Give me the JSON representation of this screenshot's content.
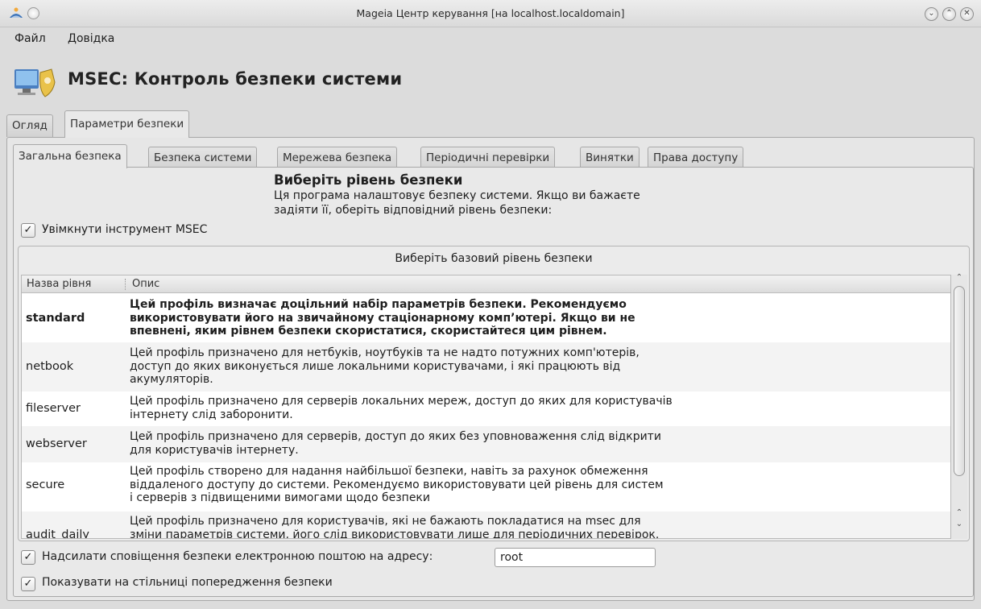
{
  "window": {
    "title": "Mageia Центр керування  [на localhost.localdomain]"
  },
  "menu": {
    "items": [
      "Файл",
      "Довідка"
    ]
  },
  "header": {
    "title": "MSEC: Контроль безпеки системи",
    "icon": "msec-shield-icon"
  },
  "main_tabs": [
    {
      "label": "Огляд",
      "active": false
    },
    {
      "label": "Параметри безпеки",
      "active": true
    }
  ],
  "sub_tabs": [
    {
      "label": "Загальна безпека",
      "active": true
    },
    {
      "label": "Безпека системи",
      "active": false
    },
    {
      "label": "Мережева безпека",
      "active": false
    },
    {
      "label": "Періодичні перевірки",
      "active": false
    },
    {
      "label": "Винятки",
      "active": false
    },
    {
      "label": "Права доступу",
      "active": false
    }
  ],
  "intro": {
    "heading": "Виберіть рівень безпеки",
    "line1": "Ця програма налаштовує безпеку системи. Якщо ви бажаєте",
    "line2": "задіяти її, оберіть відповідний рівень безпеки:"
  },
  "enable_msec": {
    "label": "Увімкнути інструмент MSEC",
    "checked": true,
    "mark": "✓"
  },
  "levels": {
    "group_title": "Виберіть базовий рівень безпеки",
    "columns": [
      "Назва рівня",
      "Опис"
    ],
    "rows": [
      {
        "name": "standard",
        "selected": true,
        "lines": [
          "Цей профіль визначає доцільний набір параметрів безпеки. Рекомендуємо",
          "використовувати його на звичайному стаціонарному комп’ютері. Якщо ви не",
          "впевнені, яким рівнем безпеки скористатися, скористайтеся цим рівнем."
        ]
      },
      {
        "name": "netbook",
        "selected": false,
        "lines": [
          "Цей профіль призначено для нетбуків, ноутбуків та не надто потужних комп'ютерів,",
          "доступ до яких виконується лише локальними користувачами, і які працюють від",
          "акумуляторів."
        ]
      },
      {
        "name": "fileserver",
        "selected": false,
        "lines": [
          "Цей профіль призначено для серверів локальних мереж, доступ до яких для користувачів",
          "інтернету слід заборонити."
        ]
      },
      {
        "name": "webserver",
        "selected": false,
        "lines": [
          "Цей профіль призначено для серверів, доступ до яких без уповноваження слід відкрити",
          "для користувачів інтернету."
        ]
      },
      {
        "name": "secure",
        "selected": false,
        "lines": [
          "Цей профіль створено для надання найбільшої безпеки, навіть за рахунок обмеження",
          "віддаленого доступу до системи. Рекомендуємо використовувати цей рівень для систем",
          "і серверів з підвищеними вимогами щодо безпеки"
        ]
      },
      {
        "name": "audit_daily",
        "selected": false,
        "lines": [
          "Цей профіль призначено для користувачів, які не бажають покладатися на msec для",
          "зміни параметрів системи, його слід використовувати лише для періодичних перевірок."
        ]
      }
    ]
  },
  "email_notify": {
    "label": "Надсилати сповіщення безпеки електронною поштою на адресу:",
    "checked": true,
    "mark": "✓",
    "value": "root"
  },
  "desktop_warn": {
    "label": "Показувати на стільниці попередження безпеки",
    "checked": true,
    "mark": "✓"
  },
  "titlebar_buttons": {
    "minimize": "⌄",
    "maximize": "⌃",
    "close": "✕"
  },
  "scroll": {
    "up": "⌃",
    "down": "⌄"
  }
}
